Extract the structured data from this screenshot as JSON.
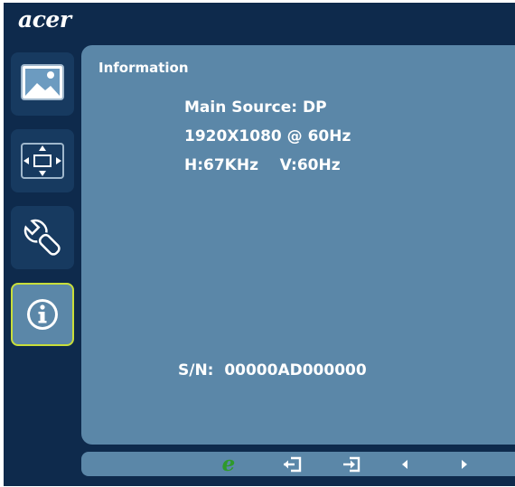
{
  "brand": {
    "logo_text": "acer"
  },
  "sidebar": {
    "items": [
      {
        "name": "picture",
        "icon": "picture-icon",
        "active": false
      },
      {
        "name": "osd-position",
        "icon": "position-arrows-icon",
        "active": false
      },
      {
        "name": "settings",
        "icon": "wrench-icon",
        "active": false
      },
      {
        "name": "information",
        "icon": "info-icon",
        "active": true
      }
    ]
  },
  "panel": {
    "title": "Information",
    "main_source": "Main Source: DP",
    "resolution": "1920X1080 @ 60Hz",
    "frequency": "H:67KHz    V:60Hz",
    "serial": "S/N:  00000AD000000"
  },
  "bottom_bar": {
    "eco_label": "e",
    "icons": [
      "eco-icon",
      "exit-icon",
      "enter-icon",
      "left-arrow-icon",
      "right-arrow-icon"
    ]
  },
  "colors": {
    "frame": "#0e2a4c",
    "panel": "#5b87a8",
    "active_border": "#c8de3a",
    "eco_green": "#2e9a2a"
  }
}
